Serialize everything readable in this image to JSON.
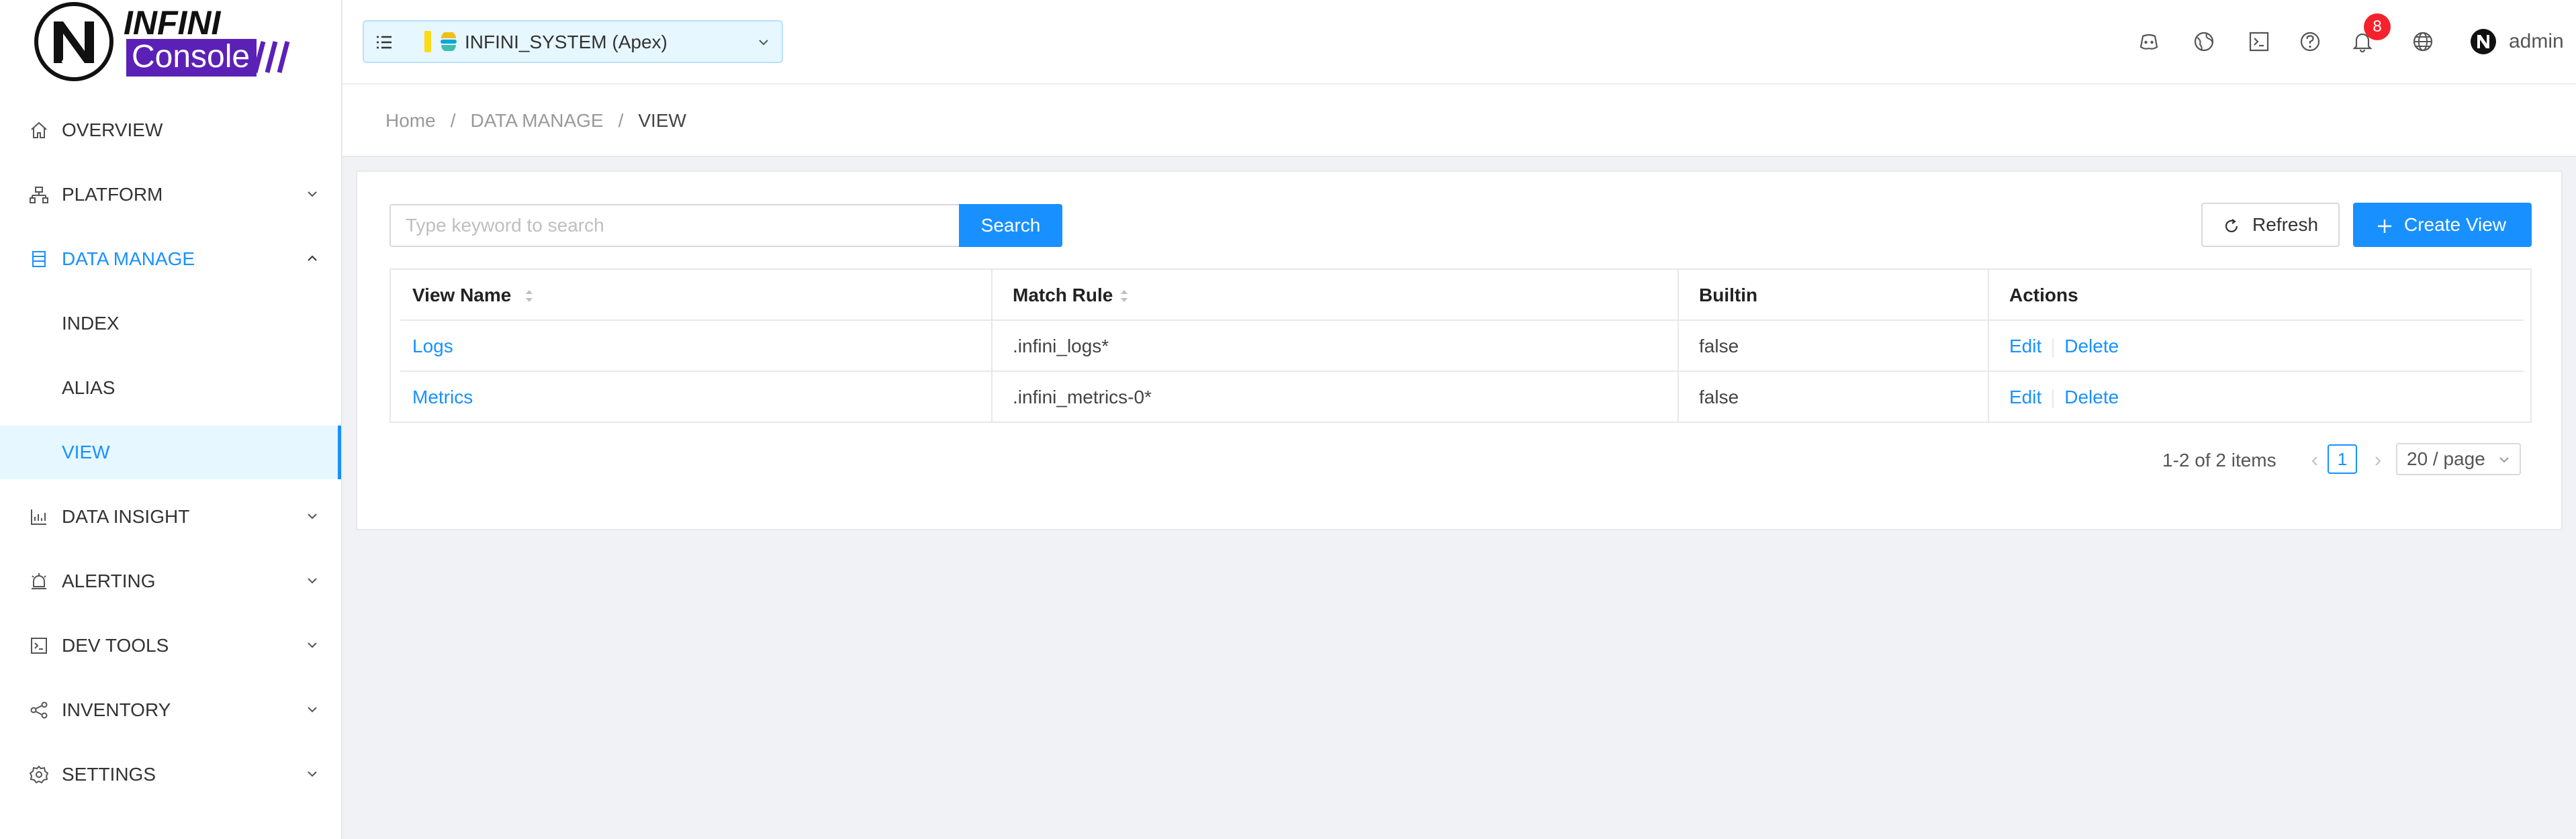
{
  "app": {
    "logo_word_top": "INFINI",
    "logo_word_bottom": "Console"
  },
  "sidebar": {
    "items": [
      {
        "label": "OVERVIEW",
        "icon": "home-icon"
      },
      {
        "label": "PLATFORM",
        "icon": "platform-icon"
      },
      {
        "label": "DATA MANAGE",
        "icon": "database-icon"
      },
      {
        "label": "INDEX"
      },
      {
        "label": "ALIAS"
      },
      {
        "label": "VIEW"
      },
      {
        "label": "DATA INSIGHT",
        "icon": "chart-icon"
      },
      {
        "label": "ALERTING",
        "icon": "alarm-icon"
      },
      {
        "label": "DEV TOOLS",
        "icon": "console-icon"
      },
      {
        "label": "INVENTORY",
        "icon": "share-icon"
      },
      {
        "label": "SETTINGS",
        "icon": "gear-icon"
      }
    ]
  },
  "header": {
    "cluster_name": "INFINI_SYSTEM (Apex)",
    "notification_count": "8",
    "username": "admin"
  },
  "breadcrumb": {
    "home": "Home",
    "section": "DATA MANAGE",
    "current": "VIEW"
  },
  "toolbar": {
    "search_placeholder": "Type keyword to search",
    "search_label": "Search",
    "refresh_label": "Refresh",
    "create_label": "Create View"
  },
  "table": {
    "columns": [
      "View Name",
      "Match Rule",
      "Builtin",
      "Actions"
    ],
    "rows": [
      {
        "name": "Logs",
        "match_rule": ".infini_logs*",
        "builtin": "false",
        "edit": "Edit",
        "delete": "Delete"
      },
      {
        "name": "Metrics",
        "match_rule": ".infini_metrics-0*",
        "builtin": "false",
        "edit": "Edit",
        "delete": "Delete"
      }
    ]
  },
  "pagination": {
    "total_text": "1-2 of 2 items",
    "current_page": "1",
    "page_size": "20 / page"
  },
  "colors": {
    "accent": "#1890ff",
    "active_bg": "#e6f7ff",
    "logo_purple": "#5b21b6",
    "badge_red": "#f5222d",
    "cluster_status": "#fadb14"
  }
}
